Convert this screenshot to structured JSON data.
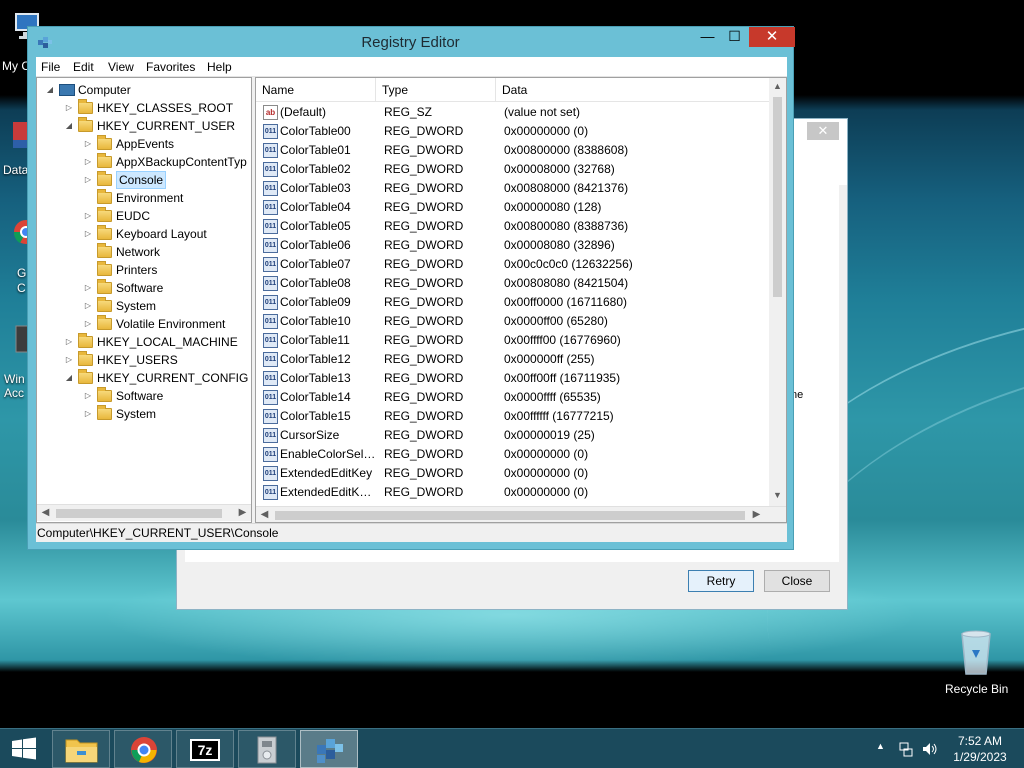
{
  "desktop": {
    "icons": [
      {
        "label": "My C",
        "icon": "computer-icon"
      },
      {
        "label": "Data",
        "icon": "database-icon"
      },
      {
        "label": "G\nC",
        "icon": "chrome-icon"
      },
      {
        "label": "Win\nAcc",
        "icon": "app-icon"
      },
      {
        "label": "Recycle Bin",
        "icon": "recycle-bin-icon"
      }
    ]
  },
  "dialog": {
    "retry_label": "Retry",
    "close_label": "Close",
    "clipped_text": "ne"
  },
  "window": {
    "title": "Registry Editor",
    "min": "—",
    "max": "☐",
    "close": "✕"
  },
  "menu": [
    "File",
    "Edit",
    "View",
    "Favorites",
    "Help"
  ],
  "tree": [
    {
      "label": "Computer",
      "level": 0,
      "arrow": "◢",
      "kind": "computer"
    },
    {
      "label": "HKEY_CLASSES_ROOT",
      "level": 1,
      "arrow": "▷",
      "kind": "folder"
    },
    {
      "label": "HKEY_CURRENT_USER",
      "level": 1,
      "arrow": "◢",
      "kind": "folder"
    },
    {
      "label": "AppEvents",
      "level": 2,
      "arrow": "▷",
      "kind": "folder"
    },
    {
      "label": "AppXBackupContentTyp",
      "level": 2,
      "arrow": "▷",
      "kind": "folder"
    },
    {
      "label": "Console",
      "level": 2,
      "arrow": "▷",
      "kind": "folder",
      "selected": true
    },
    {
      "label": "Environment",
      "level": 2,
      "arrow": "",
      "kind": "folder"
    },
    {
      "label": "EUDC",
      "level": 2,
      "arrow": "▷",
      "kind": "folder"
    },
    {
      "label": "Keyboard Layout",
      "level": 2,
      "arrow": "▷",
      "kind": "folder"
    },
    {
      "label": "Network",
      "level": 2,
      "arrow": "",
      "kind": "folder"
    },
    {
      "label": "Printers",
      "level": 2,
      "arrow": "",
      "kind": "folder"
    },
    {
      "label": "Software",
      "level": 2,
      "arrow": "▷",
      "kind": "folder"
    },
    {
      "label": "System",
      "level": 2,
      "arrow": "▷",
      "kind": "folder"
    },
    {
      "label": "Volatile Environment",
      "level": 2,
      "arrow": "▷",
      "kind": "folder"
    },
    {
      "label": "HKEY_LOCAL_MACHINE",
      "level": 1,
      "arrow": "▷",
      "kind": "folder"
    },
    {
      "label": "HKEY_USERS",
      "level": 1,
      "arrow": "▷",
      "kind": "folder"
    },
    {
      "label": "HKEY_CURRENT_CONFIG",
      "level": 1,
      "arrow": "◢",
      "kind": "folder"
    },
    {
      "label": "Software",
      "level": 2,
      "arrow": "▷",
      "kind": "folder"
    },
    {
      "label": "System",
      "level": 2,
      "arrow": "▷",
      "kind": "folder"
    }
  ],
  "columns": [
    "Name",
    "Type",
    "Data"
  ],
  "values": [
    {
      "name": "(Default)",
      "type": "REG_SZ",
      "data": "(value not set)",
      "icon": "ab"
    },
    {
      "name": "ColorTable00",
      "type": "REG_DWORD",
      "data": "0x00000000 (0)",
      "icon": "dw"
    },
    {
      "name": "ColorTable01",
      "type": "REG_DWORD",
      "data": "0x00800000 (8388608)",
      "icon": "dw"
    },
    {
      "name": "ColorTable02",
      "type": "REG_DWORD",
      "data": "0x00008000 (32768)",
      "icon": "dw"
    },
    {
      "name": "ColorTable03",
      "type": "REG_DWORD",
      "data": "0x00808000 (8421376)",
      "icon": "dw"
    },
    {
      "name": "ColorTable04",
      "type": "REG_DWORD",
      "data": "0x00000080 (128)",
      "icon": "dw"
    },
    {
      "name": "ColorTable05",
      "type": "REG_DWORD",
      "data": "0x00800080 (8388736)",
      "icon": "dw"
    },
    {
      "name": "ColorTable06",
      "type": "REG_DWORD",
      "data": "0x00008080 (32896)",
      "icon": "dw"
    },
    {
      "name": "ColorTable07",
      "type": "REG_DWORD",
      "data": "0x00c0c0c0 (12632256)",
      "icon": "dw"
    },
    {
      "name": "ColorTable08",
      "type": "REG_DWORD",
      "data": "0x00808080 (8421504)",
      "icon": "dw"
    },
    {
      "name": "ColorTable09",
      "type": "REG_DWORD",
      "data": "0x00ff0000 (16711680)",
      "icon": "dw"
    },
    {
      "name": "ColorTable10",
      "type": "REG_DWORD",
      "data": "0x0000ff00 (65280)",
      "icon": "dw"
    },
    {
      "name": "ColorTable11",
      "type": "REG_DWORD",
      "data": "0x00ffff00 (16776960)",
      "icon": "dw"
    },
    {
      "name": "ColorTable12",
      "type": "REG_DWORD",
      "data": "0x000000ff (255)",
      "icon": "dw"
    },
    {
      "name": "ColorTable13",
      "type": "REG_DWORD",
      "data": "0x00ff00ff (16711935)",
      "icon": "dw"
    },
    {
      "name": "ColorTable14",
      "type": "REG_DWORD",
      "data": "0x0000ffff (65535)",
      "icon": "dw"
    },
    {
      "name": "ColorTable15",
      "type": "REG_DWORD",
      "data": "0x00ffffff (16777215)",
      "icon": "dw"
    },
    {
      "name": "CursorSize",
      "type": "REG_DWORD",
      "data": "0x00000019 (25)",
      "icon": "dw"
    },
    {
      "name": "EnableColorSele...",
      "type": "REG_DWORD",
      "data": "0x00000000 (0)",
      "icon": "dw"
    },
    {
      "name": "ExtendedEditKey",
      "type": "REG_DWORD",
      "data": "0x00000000 (0)",
      "icon": "dw"
    },
    {
      "name": "ExtendedEditKey...",
      "type": "REG_DWORD",
      "data": "0x00000000 (0)",
      "icon": "dw"
    }
  ],
  "status": "Computer\\HKEY_CURRENT_USER\\Console",
  "taskbar": {
    "apps": [
      {
        "name": "file-explorer",
        "icon": "folder-icon",
        "active": false
      },
      {
        "name": "chrome",
        "icon": "chrome-icon",
        "active": false
      },
      {
        "name": "7zip",
        "icon": "7zip-icon",
        "active": false,
        "text": "7z"
      },
      {
        "name": "installer",
        "icon": "installer-icon",
        "active": false
      },
      {
        "name": "registry-editor",
        "icon": "regedit-icon",
        "active": true
      }
    ],
    "time": "7:52 AM",
    "date": "1/29/2023"
  },
  "colors": {
    "accent": "#6bc0d6",
    "close_red": "#c7392b",
    "selection": "#cde8ff"
  }
}
